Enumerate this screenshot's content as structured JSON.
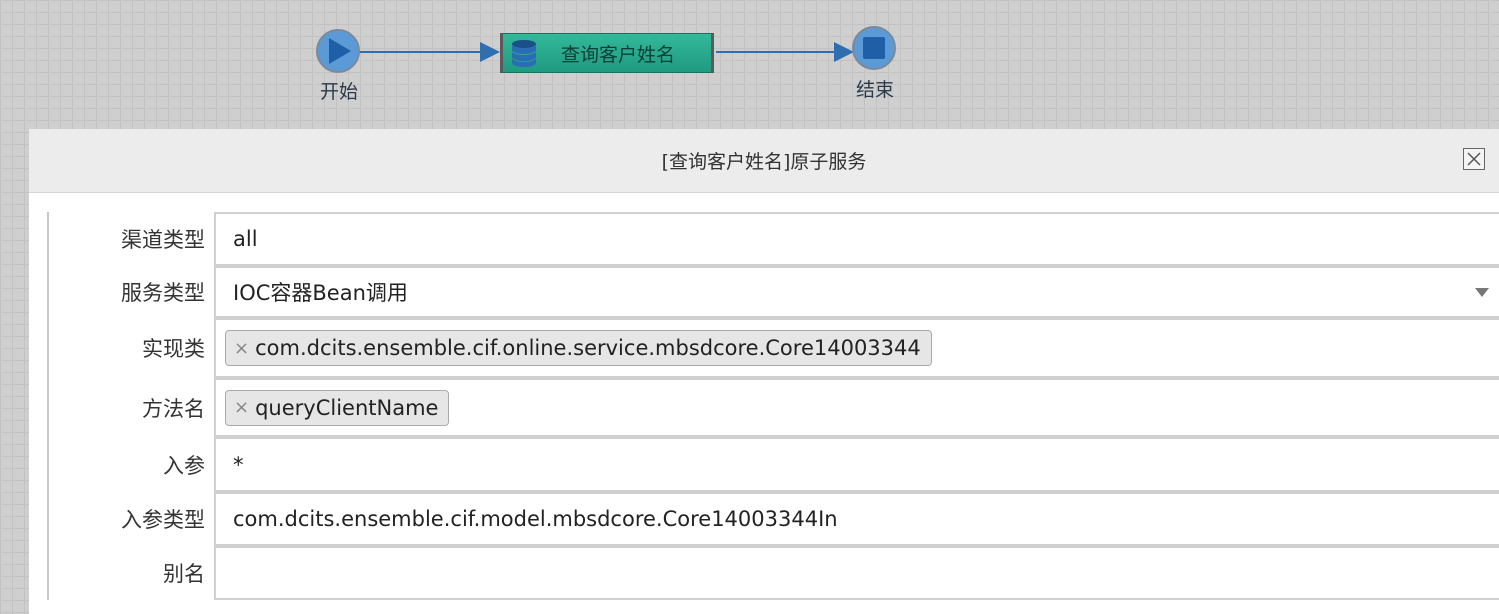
{
  "flow": {
    "start_label": "开始",
    "task_label": "查询客户姓名",
    "end_label": "结束",
    "colors": {
      "node_blue": "#2f7fc3",
      "task_green": "#2aa98d",
      "arrow": "#2f6fb0"
    }
  },
  "dialog": {
    "title": "[查询客户姓名]原子服务",
    "close_icon": "close-icon",
    "fields": {
      "channel_type": {
        "label": "渠道类型",
        "value": "all"
      },
      "service_type": {
        "label": "服务类型",
        "value": "IOC容器Bean调用"
      },
      "impl_class": {
        "label": "实现类",
        "tag": "com.dcits.ensemble.cif.online.service.mbsdcore.Core14003344",
        "tag_remove": "×"
      },
      "method_name": {
        "label": "方法名",
        "tag": "queryClientName",
        "tag_remove": "×"
      },
      "input_param": {
        "label": "入参",
        "value": "*"
      },
      "input_param_type": {
        "label": "入参类型",
        "value": "com.dcits.ensemble.cif.model.mbsdcore.Core14003344In"
      },
      "alias": {
        "label": "别名",
        "value": ""
      }
    }
  }
}
